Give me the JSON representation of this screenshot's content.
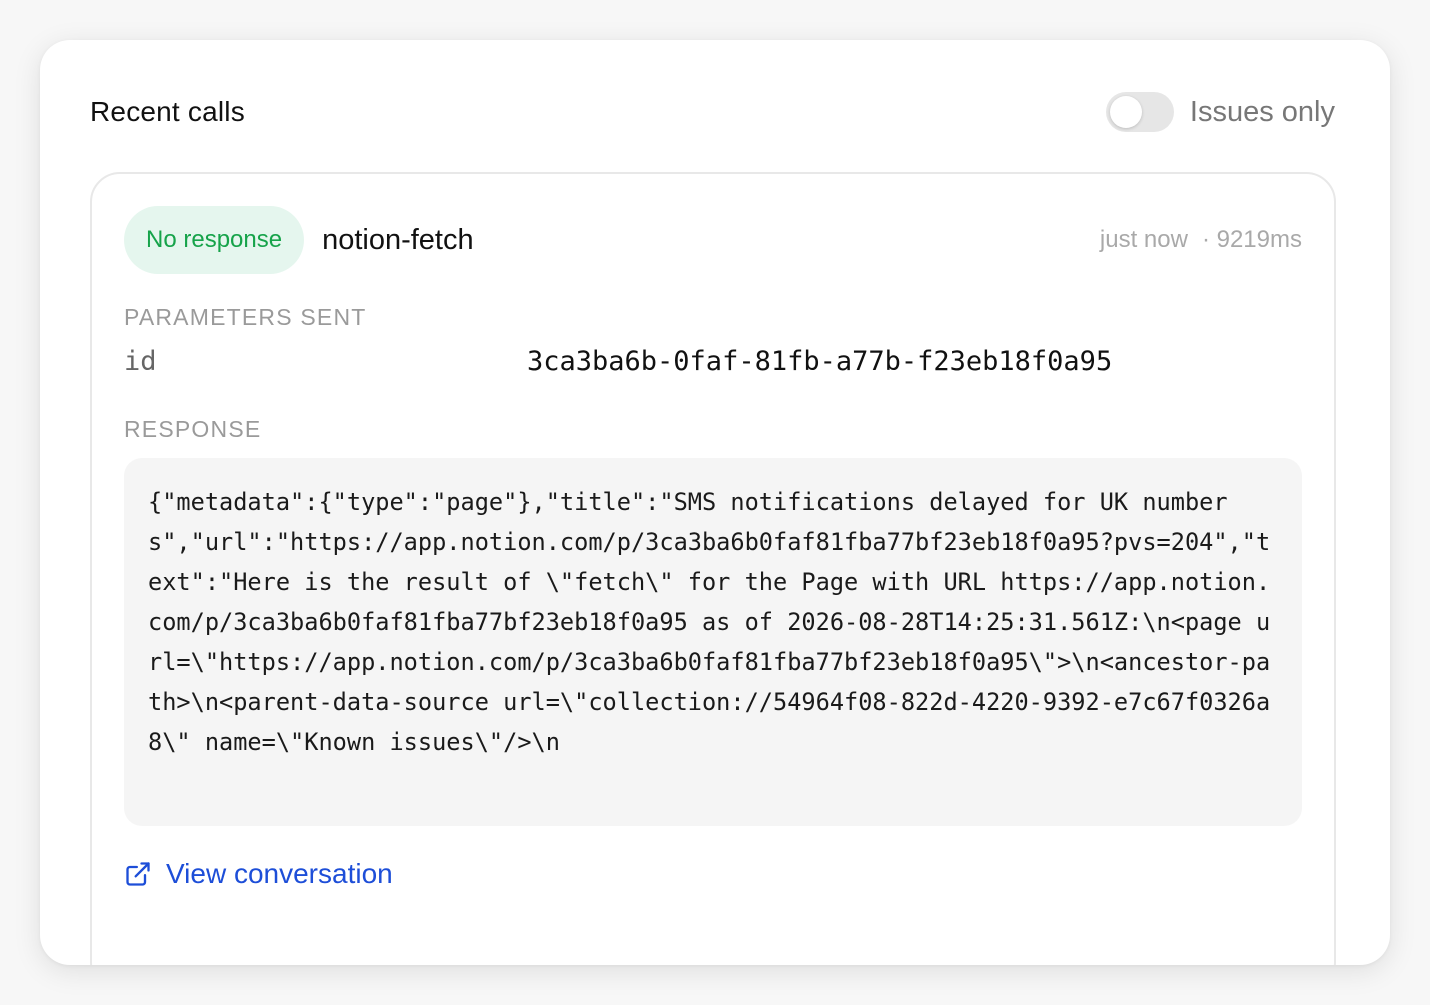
{
  "header": {
    "title": "Recent calls",
    "toggle_label": "Issues only",
    "toggle_on": false
  },
  "call": {
    "status_badge": "No response",
    "status_color": "#16a34a",
    "tool_name": "notion-fetch",
    "time": "just now",
    "duration": "· 9219ms",
    "params_label": "PARAMETERS SENT",
    "params": [
      {
        "key": "id",
        "value": "3ca3ba6b-0faf-81fb-a77b-f23eb18f0a95"
      }
    ],
    "response_label": "RESPONSE",
    "response_text": "{\"metadata\":{\"type\":\"page\"},\"title\":\"SMS notifications delayed for UK numbers\",\"url\":\"https://app.notion.com/p/3ca3ba6b0faf81fba77bf23eb18f0a95?pvs=204\",\"text\":\"Here is the result of \\\"fetch\\\" for the Page with URL https://app.notion.com/p/3ca3ba6b0faf81fba77bf23eb18f0a95 as of 2026-08-28T14:25:31.561Z:\\n<page url=\\\"https://app.notion.com/p/3ca3ba6b0faf81fba77bf23eb18f0a95\\\">\\n<ancestor-path>\\n<parent-data-source url=\\\"collection://54964f08-822d-4220-9392-e7c67f0326a8\\\" name=\\\"Known issues\\\"/>\\n",
    "view_link_label": "View conversation",
    "link_color": "#1d4ed8"
  }
}
